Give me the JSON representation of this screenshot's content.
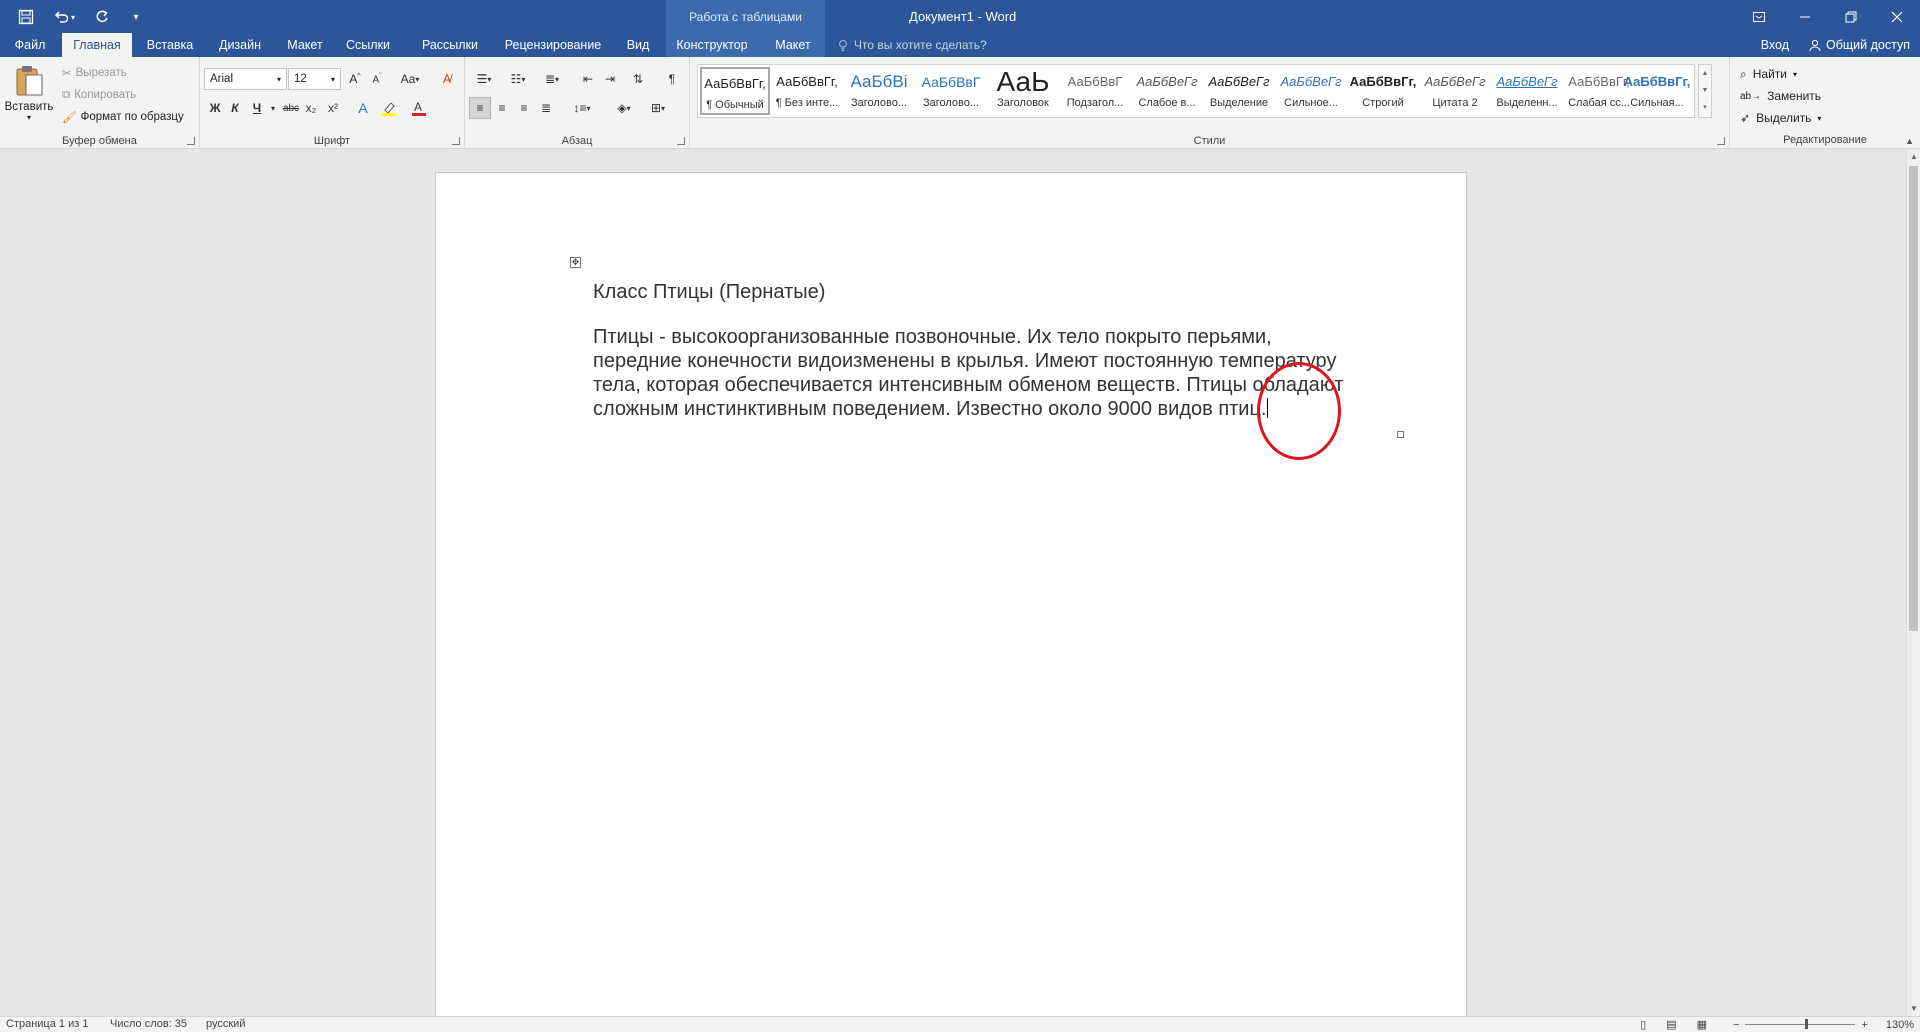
{
  "window": {
    "title": "Документ1 - Word",
    "context_band": "Работа с таблицами"
  },
  "tabs": [
    "Файл",
    "Главная",
    "Вставка",
    "Дизайн",
    "Макет",
    "Ссылки",
    "Рассылки",
    "Рецензирование",
    "Вид",
    "Конструктор",
    "Макет"
  ],
  "active_tab": "Главная",
  "tell_me": "Что вы хотите сделать?",
  "account": {
    "signin": "Вход",
    "share": "Общий доступ"
  },
  "clipboard": {
    "paste": "Вставить",
    "cut": "Вырезать",
    "copy": "Копировать",
    "format_painter": "Формат по образцу",
    "label": "Буфер обмена"
  },
  "font": {
    "name": "Arial",
    "size": "12",
    "label": "Шрифт",
    "bold": "Ж",
    "italic": "К",
    "underline": "Ч",
    "strike": "abc",
    "sub": "x₂",
    "sup": "x²",
    "case": "Aa"
  },
  "paragraph": {
    "label": "Абзац"
  },
  "styles": {
    "label": "Стили",
    "items": [
      {
        "preview": "АаБбВвГг,",
        "name": "¶ Обычный"
      },
      {
        "preview": "АаБбВвГг,",
        "name": "¶ Без инте..."
      },
      {
        "preview": "АаБбВі",
        "name": "Заголово..."
      },
      {
        "preview": "АаБбВвГ",
        "name": "Заголово..."
      },
      {
        "preview": "АаЬ",
        "name": "Заголовок"
      },
      {
        "preview": "АаБбВвГ",
        "name": "Подзагол..."
      },
      {
        "preview": "АаБбВеГг",
        "name": "Слабое в..."
      },
      {
        "preview": "АаБбВеГг",
        "name": "Выделение"
      },
      {
        "preview": "АаБбВеГг",
        "name": "Сильное..."
      },
      {
        "preview": "АаБбВвГг,",
        "name": "Строгий"
      },
      {
        "preview": "АаБбВеГг",
        "name": "Цитата 2"
      },
      {
        "preview": "АаБбВеГг",
        "name": "Выделенн..."
      },
      {
        "preview": "АаБбВвГг,",
        "name": "Слабая сс..."
      },
      {
        "preview": "АаБбВвГг,",
        "name": "Сильная..."
      }
    ]
  },
  "editing": {
    "label": "Редактирование",
    "find": "Найти",
    "replace": "Заменить",
    "select": "Выделить"
  },
  "document": {
    "heading": "Класс Птицы (Пернатые)",
    "lines": [
      "Птицы - высокоорганизованные позвоночные. Их тело покрыто перьями,",
      "передние конечности видоизменены в крылья. Имеют постоянную температуру",
      "тела, которая обеспечивается интенсивным обменом веществ. Птицы обладают",
      "сложным инстинктивным поведением. Известно около 9000 видов птиц."
    ]
  },
  "status": {
    "page": "Страница 1 из 1",
    "words": "Число слов: 35",
    "language": "русский",
    "zoom": "130%"
  },
  "colors": {
    "brand": "#2b579a",
    "annotation": "#e0141e",
    "highlight": "#ffff00",
    "font_color": "#e02020"
  }
}
